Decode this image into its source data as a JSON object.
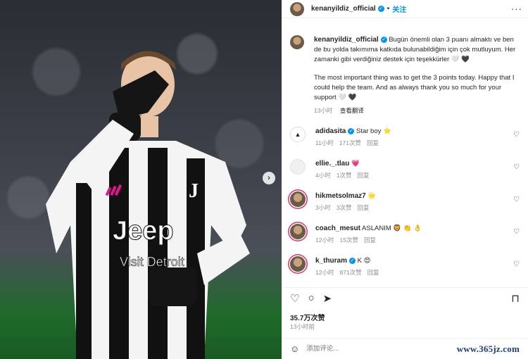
{
  "header": {
    "username": "kenanyildiz_official",
    "follow_label": "关注",
    "more_icon": "more-icon"
  },
  "caption": {
    "username": "kenanyildiz_official",
    "text_tr": "Bugün önemli olan 3 puanı almaktı ve ben de bu yolda takımıma katkıda bulunabildiğim için çok mutluyum. Her zamanki gibi verdiğiniz destek için teşekkürler 🤍 🖤",
    "text_en": "The most important thing was to get the 3 points today. Happy that I could help the team. And as always thank you so much for your support 🤍 🖤",
    "time": "13小时",
    "translate_label": "查看翻译"
  },
  "comments": [
    {
      "username": "adidasita",
      "verified": true,
      "text": "Star boy ⭐",
      "time": "11小时",
      "likes": "171次赞",
      "reply": "回复"
    },
    {
      "username": "ellie._.tlau",
      "verified": false,
      "text": "💗",
      "time": "4小时",
      "likes": "1次赞",
      "reply": "回复"
    },
    {
      "username": "hikmetsolmaz7",
      "verified": false,
      "text": "🌟",
      "time": "3小时",
      "likes": "3次赞",
      "reply": "回复"
    },
    {
      "username": "coach_mesut",
      "verified": false,
      "text": "ASLANIM 🦁 👏 👌",
      "time": "12小时",
      "likes": "15次赞",
      "reply": "回复"
    },
    {
      "username": "k_thuram",
      "verified": true,
      "text": "K 😍",
      "time": "12小时",
      "likes": "871次赞",
      "reply": "回复"
    }
  ],
  "actions": {
    "like_icon": "heart-icon",
    "comment_icon": "comment-icon",
    "share_icon": "share-icon",
    "save_icon": "bookmark-icon"
  },
  "likes_count": "35.7万次赞",
  "post_time": "13小时前",
  "comment_input": {
    "placeholder": "添加评论..."
  },
  "watermark": "www.365jz.com",
  "photo": {
    "jersey_text": "Jeep",
    "jersey_subtext": "Visit Detroit"
  }
}
